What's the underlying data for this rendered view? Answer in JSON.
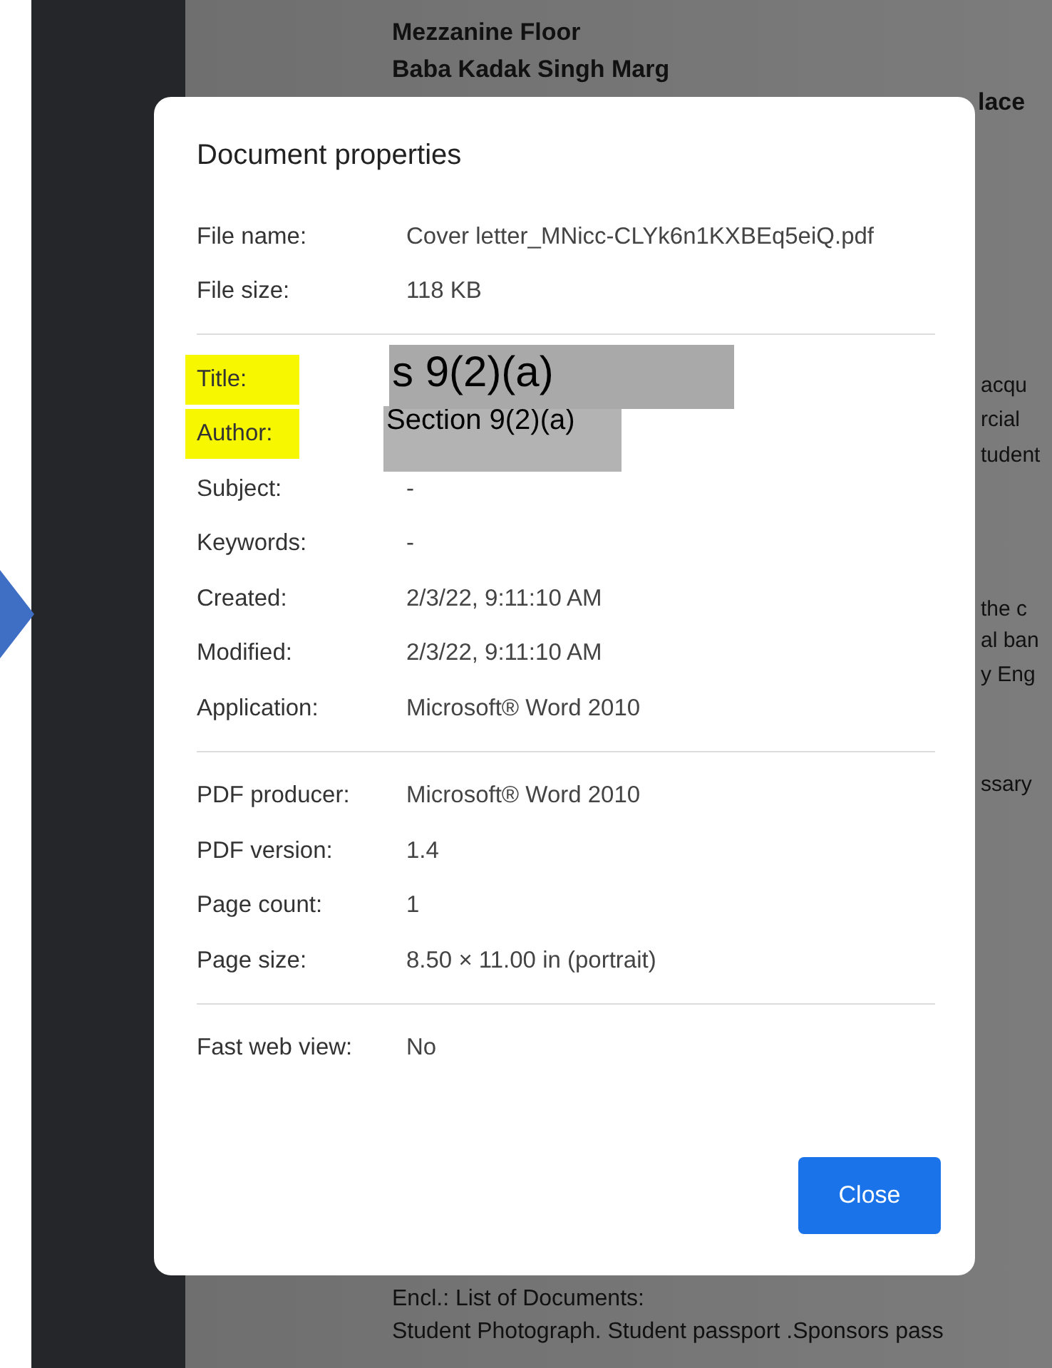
{
  "document_background": {
    "address_lines": [
      "Mezzanine Floor",
      "Baba Kadak Singh Marg"
    ],
    "cut_line": "lace",
    "right_fragments": [
      "acqu",
      "rcial",
      "tudent",
      "the c",
      "al ban",
      "y Eng",
      "ssary"
    ],
    "bottom_lines": [
      "Encl.: List of Documents:",
      "Student Photograph. Student passport .Sponsors pass"
    ]
  },
  "dialog": {
    "title": "Document properties",
    "sections": [
      [
        {
          "kind": "plain",
          "label": "File name:",
          "value": "Cover letter_MNicc-CLYk6n1KXBEq5eiQ.pdf",
          "highlighted": false
        },
        {
          "kind": "plain",
          "label": "File size:",
          "value": "118 KB",
          "highlighted": false
        }
      ],
      [
        {
          "kind": "redacted",
          "label": "Title:",
          "value": "s 9(2)(a)",
          "highlighted": true
        },
        {
          "kind": "redacted",
          "label": "Author:",
          "value": "Section 9(2)(a)",
          "highlighted": true
        },
        {
          "kind": "plain",
          "label": "Subject:",
          "value": "-",
          "highlighted": false
        },
        {
          "kind": "plain",
          "label": "Keywords:",
          "value": "-",
          "highlighted": false
        },
        {
          "kind": "plain",
          "label": "Created:",
          "value": "2/3/22, 9:11:10 AM",
          "highlighted": false
        },
        {
          "kind": "plain",
          "label": "Modified:",
          "value": "2/3/22, 9:11:10 AM",
          "highlighted": false
        },
        {
          "kind": "plain",
          "label": "Application:",
          "value": "Microsoft® Word 2010",
          "highlighted": false
        }
      ],
      [
        {
          "kind": "plain",
          "label": "PDF producer:",
          "value": "Microsoft® Word 2010",
          "highlighted": false
        },
        {
          "kind": "plain",
          "label": "PDF version:",
          "value": "1.4",
          "highlighted": false
        },
        {
          "kind": "plain",
          "label": "Page count:",
          "value": "1",
          "highlighted": false
        },
        {
          "kind": "plain",
          "label": "Page size:",
          "value": "8.50 × 11.00 in (portrait)",
          "highlighted": false
        }
      ],
      [
        {
          "kind": "plain",
          "label": "Fast web view:",
          "value": "No",
          "highlighted": false
        }
      ]
    ],
    "close_button": "Close"
  }
}
